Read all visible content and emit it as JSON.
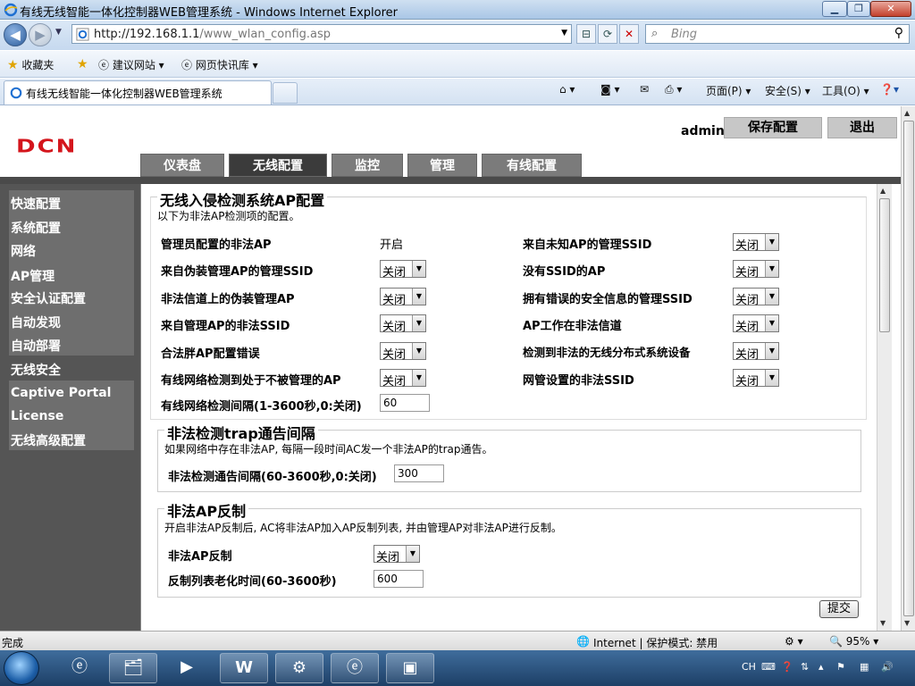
{
  "browser": {
    "window_title": "有线无线智能一体化控制器WEB管理系统 - Windows Internet Explorer",
    "url_host": "http://192.168.1.1",
    "url_path": "/www_wlan_config.asp",
    "search_placeholder": "Bing",
    "favorites_label": "收藏夹",
    "fav_links": [
      "建议网站 ▾",
      "网页快讯库 ▾"
    ],
    "tab_title": "有线无线智能一体化控制器WEB管理系统",
    "tools": [
      "页面(P) ▾",
      "安全(S) ▾",
      "工具(O) ▾"
    ]
  },
  "header": {
    "logo": "DCN",
    "user": "admin",
    "save_label": "保存配置",
    "logout_label": "退出"
  },
  "nav_tabs": [
    "仪表盘",
    "无线配置",
    "监控",
    "管理",
    "有线配置"
  ],
  "sidebar": [
    "快速配置",
    "系统配置",
    "网络",
    "AP管理",
    "安全认证配置",
    "自动发现",
    "自动部署",
    "无线安全",
    "Captive Portal",
    "License",
    "无线高级配置"
  ],
  "ids_section": {
    "title": "无线入侵检测系统AP配置",
    "desc": "以下为非法AP检测项的配置。",
    "left": [
      {
        "label": "管理员配置的非法AP",
        "value": "开启"
      },
      {
        "label": "来自伪装管理AP的管理SSID",
        "value": "关闭"
      },
      {
        "label": "非法信道上的伪装管理AP",
        "value": "关闭"
      },
      {
        "label": "来自管理AP的非法SSID",
        "value": "关闭"
      },
      {
        "label": "合法胖AP配置错误",
        "value": "关闭"
      },
      {
        "label": "有线网络检测到处于不被管理的AP",
        "value": "关闭"
      }
    ],
    "right": [
      {
        "label": "来自未知AP的管理SSID",
        "value": "关闭"
      },
      {
        "label": "没有SSID的AP",
        "value": "关闭"
      },
      {
        "label": "拥有错误的安全信息的管理SSID",
        "value": "关闭"
      },
      {
        "label": "AP工作在非法信道",
        "value": "关闭"
      },
      {
        "label": "检测到非法的无线分布式系统设备",
        "value": "关闭"
      },
      {
        "label": "网管设置的非法SSID",
        "value": "关闭"
      }
    ],
    "interval_label": "有线网络检测间隔(1-3600秒,0:关闭)",
    "interval_value": "60"
  },
  "trap_section": {
    "title": "非法检测trap通告间隔",
    "desc": "如果网络中存在非法AP, 每隔一段时间AC发一个非法AP的trap通告。",
    "interval_label": "非法检测通告间隔(60-3600秒,0:关闭)",
    "interval_value": "300"
  },
  "counter_section": {
    "title": "非法AP反制",
    "desc": "开启非法AP反制后, AC将非法AP加入AP反制列表, 并由管理AP对非法AP进行反制。",
    "counter_label": "非法AP反制",
    "counter_value": "关闭",
    "aging_label": "反制列表老化时间(60-3600秒)",
    "aging_value": "600"
  },
  "submit_label": "提交",
  "status": {
    "left": "完成",
    "zone": "Internet | 保护模式: 禁用",
    "zoom": "95%"
  },
  "taskbar": {
    "lang": "CH"
  },
  "colors": {
    "logo_red": "#d4151c",
    "nav_tab": "#7b7b7b",
    "nav_tab_active": "#3b3b3b",
    "sidebar_bg": "#555555"
  }
}
